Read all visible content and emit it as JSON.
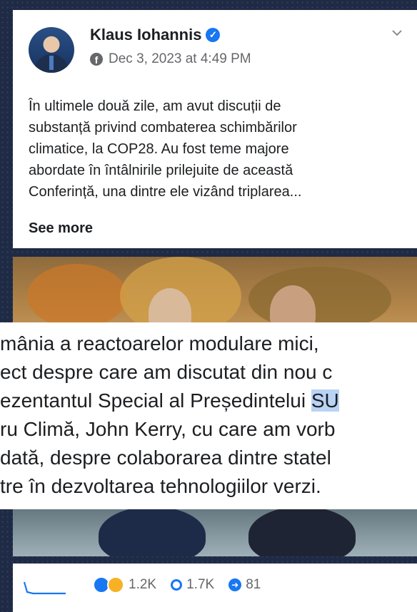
{
  "post": {
    "author": "Klaus Iohannis",
    "timestamp": "Dec 3, 2023 at 4:49 PM",
    "text_lines": [
      "În ultimele două zile, am avut discuții de",
      "substanță privind combaterea schimbărilor",
      "climatice, la COP28. Au fost teme majore",
      "abordate în întâlnirile prilejuite de această",
      "Conferință, una dintre ele vizând triplarea..."
    ],
    "see_more": "See more"
  },
  "overlay": {
    "lines": [
      "mânia a reactoarelor modulare mici,",
      "ect despre care am discutat din nou c",
      "ezentantul Special al Președintelui ",
      "ru Climă, John Kerry, cu care am vorb",
      "dată, despre colaborarea dintre statel",
      "tre în dezvoltarea tehnologiilor verzi."
    ],
    "highlight": "SU"
  },
  "footer": {
    "reactions": "1.2K",
    "comments": "1.7K",
    "shares": "81"
  },
  "colors": {
    "accent": "#1877f2",
    "highlight": "#b9d3f4"
  },
  "icons": [
    "verified-badge-icon",
    "facebook-icon",
    "chevron-down-icon",
    "sparkline-icon",
    "reaction-icon",
    "comment-icon",
    "share-icon"
  ]
}
